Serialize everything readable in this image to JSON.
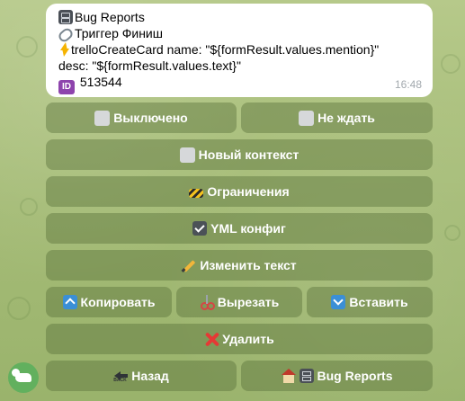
{
  "message": {
    "line1_text": "Bug Reports",
    "line1_icon": "file-cabinet-icon",
    "line2_text": "Триггер Финиш",
    "line2_icon": "link-icon",
    "line3_text": "trelloCreateCard name: \"${formResult.values.mention}\"",
    "line3_icon": "lightning-icon",
    "line4_text": "desc: \"${formResult.values.text}\"",
    "line5_text": "513544",
    "line5_badge": "ID",
    "time": "16:48"
  },
  "keyboard": {
    "disabled_label": "Выключено",
    "no_wait_label": "Не ждать",
    "new_context_label": "Новый контекст",
    "restrictions_label": "Ограничения",
    "yml_config_label": "YML конфиг",
    "edit_text_label": "Изменить текст",
    "copy_label": "Копировать",
    "cut_label": "Вырезать",
    "paste_label": "Вставить",
    "delete_label": "Удалить",
    "back_label": "Назад",
    "home_label": "Bug Reports"
  },
  "colors": {
    "background": "#a9c07a",
    "button_fill": "rgba(86,110,56,0.42)",
    "bubble": "#ffffff",
    "fab": "#62b05e"
  }
}
